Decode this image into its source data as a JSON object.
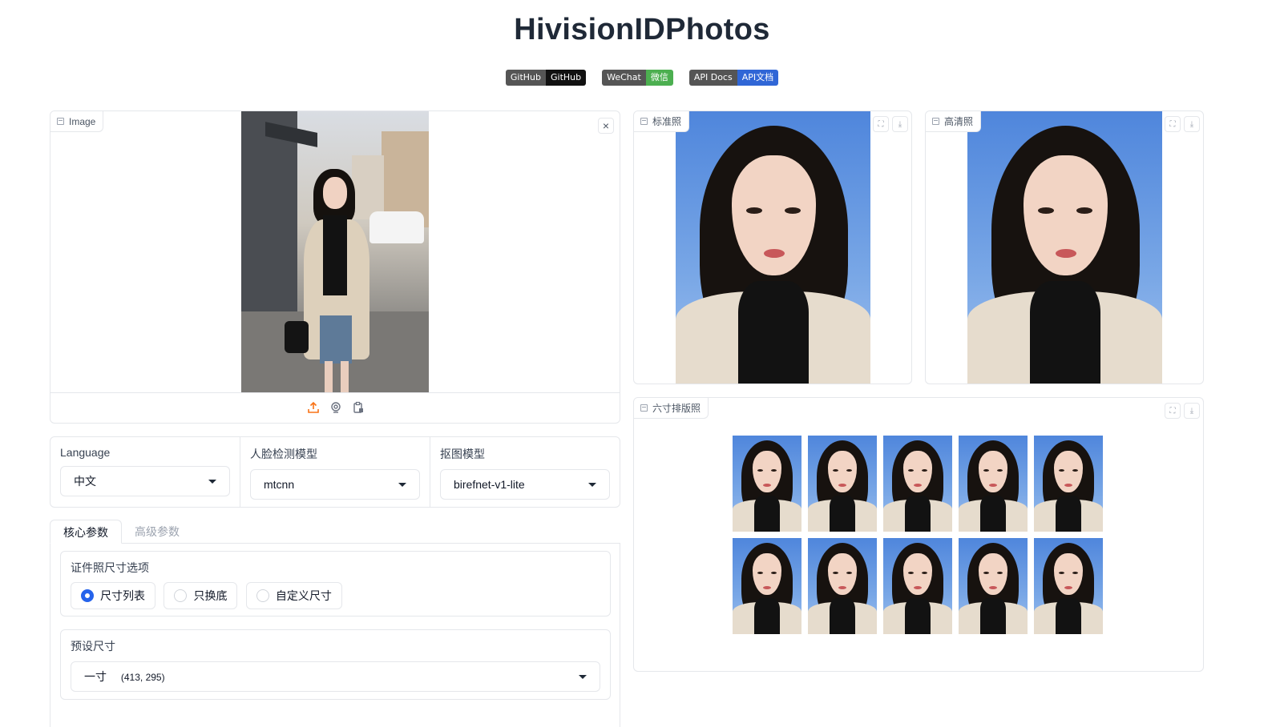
{
  "header": {
    "title": "HivisionIDPhotos",
    "badges": [
      {
        "left": "GitHub",
        "right": "GitHub",
        "color": "#111111"
      },
      {
        "left": "WeChat",
        "right": "微信",
        "color": "#4caf50"
      },
      {
        "left": "API Docs",
        "right": "API文档",
        "color": "#3066d6"
      }
    ]
  },
  "input_panel": {
    "label": "Image",
    "close_label": "×"
  },
  "outputs": {
    "standard_label": "标准照",
    "hd_label": "高清照",
    "layout_label": "六寸排版照"
  },
  "settings": {
    "language": {
      "label": "Language",
      "value": "中文"
    },
    "face_model": {
      "label": "人脸检测模型",
      "value": "mtcnn"
    },
    "matting_model": {
      "label": "抠图模型",
      "value": "birefnet-v1-lite"
    }
  },
  "tabs": [
    {
      "label": "核心参数",
      "active": true
    },
    {
      "label": "高级参数",
      "active": false
    }
  ],
  "size_options": {
    "label": "证件照尺寸选项",
    "options": [
      {
        "label": "尺寸列表",
        "selected": true
      },
      {
        "label": "只换底",
        "selected": false
      },
      {
        "label": "自定义尺寸",
        "selected": false
      }
    ]
  },
  "preset": {
    "label": "预设尺寸",
    "value_name": "一寸",
    "value_size": "(413, 295)"
  },
  "colors": {
    "accent": "#2563eb",
    "upload_icon": "#f97316",
    "photo_bg": "#5b8ee0"
  }
}
